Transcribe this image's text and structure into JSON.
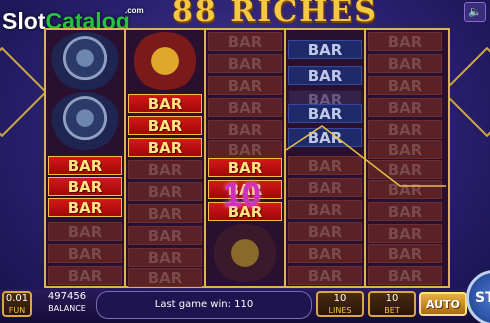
{
  "title": "88 RICHES",
  "logo": {
    "part1": "Slot",
    "part2": "Catalog",
    "suffix": ".com"
  },
  "reel_layout": [
    [
      {
        "t": "watch"
      },
      {
        "t": "watch"
      },
      {
        "t": "bar",
        "s": "red"
      },
      {
        "t": "bar",
        "s": "red"
      },
      {
        "t": "bar",
        "s": "red"
      },
      {
        "t": "bar",
        "s": "dim"
      },
      {
        "t": "bar",
        "s": "dim"
      },
      {
        "t": "bar",
        "s": "dim"
      }
    ],
    [
      {
        "t": "gold"
      },
      {
        "t": "bar",
        "s": "red"
      },
      {
        "t": "bar",
        "s": "red"
      },
      {
        "t": "bar",
        "s": "red"
      },
      {
        "t": "bar",
        "s": "dim"
      },
      {
        "t": "bar",
        "s": "dim"
      },
      {
        "t": "bar",
        "s": "dim"
      },
      {
        "t": "bar",
        "s": "dim"
      },
      {
        "t": "bar",
        "s": "dim"
      },
      {
        "t": "bar",
        "s": "dim"
      }
    ],
    [
      {
        "t": "bar",
        "s": "dim"
      },
      {
        "t": "bar",
        "s": "dim"
      },
      {
        "t": "bar",
        "s": "dim"
      },
      {
        "t": "bar",
        "s": "dim"
      },
      {
        "t": "bar",
        "s": "dim"
      },
      {
        "t": "bar",
        "s": "dim"
      },
      {
        "t": "bar",
        "s": "red"
      },
      {
        "t": "bar",
        "s": "red"
      },
      {
        "t": "bar",
        "s": "red"
      },
      {
        "t": "gold-dim"
      }
    ],
    [
      {
        "t": "bar",
        "s": "navy"
      },
      {
        "t": "bar",
        "s": "navy"
      },
      {
        "t": "bar",
        "s": "dark"
      },
      {
        "t": "bar",
        "s": "navy"
      },
      {
        "t": "bar",
        "s": "navy"
      },
      {
        "t": "bar",
        "s": "dim"
      },
      {
        "t": "bar",
        "s": "dim"
      },
      {
        "t": "bar",
        "s": "dim"
      },
      {
        "t": "bar",
        "s": "dim"
      },
      {
        "t": "bar",
        "s": "dim"
      },
      {
        "t": "bar",
        "s": "dim"
      },
      {
        "t": "bar",
        "s": "dim"
      }
    ],
    [
      {
        "t": "bar",
        "s": "dim"
      },
      {
        "t": "bar",
        "s": "dim"
      },
      {
        "t": "bar",
        "s": "dim"
      },
      {
        "t": "bar",
        "s": "dim"
      },
      {
        "t": "bar",
        "s": "dim"
      },
      {
        "t": "bar",
        "s": "dim"
      },
      {
        "t": "bar",
        "s": "dim"
      },
      {
        "t": "bar",
        "s": "dim"
      },
      {
        "t": "bar",
        "s": "dim"
      },
      {
        "t": "bar",
        "s": "dim"
      },
      {
        "t": "bar",
        "s": "dim"
      },
      {
        "t": "bar",
        "s": "dim"
      }
    ]
  ],
  "bar_label": "BAR",
  "win_amount": "10",
  "coin": {
    "value": "0.01",
    "label": "FUN"
  },
  "balance": {
    "value": "497456",
    "label": "BALANCE"
  },
  "message": "Last game win: 110",
  "lines": {
    "value": "10",
    "label": "LINES"
  },
  "bet": {
    "value": "10",
    "label": "BET"
  },
  "auto_label": "AUTO",
  "spin_label": "ST",
  "sound_icon": "speaker-icon",
  "colors": {
    "bar_red": "#d21818",
    "gold": "#f5c842",
    "win": "#d030c0"
  }
}
